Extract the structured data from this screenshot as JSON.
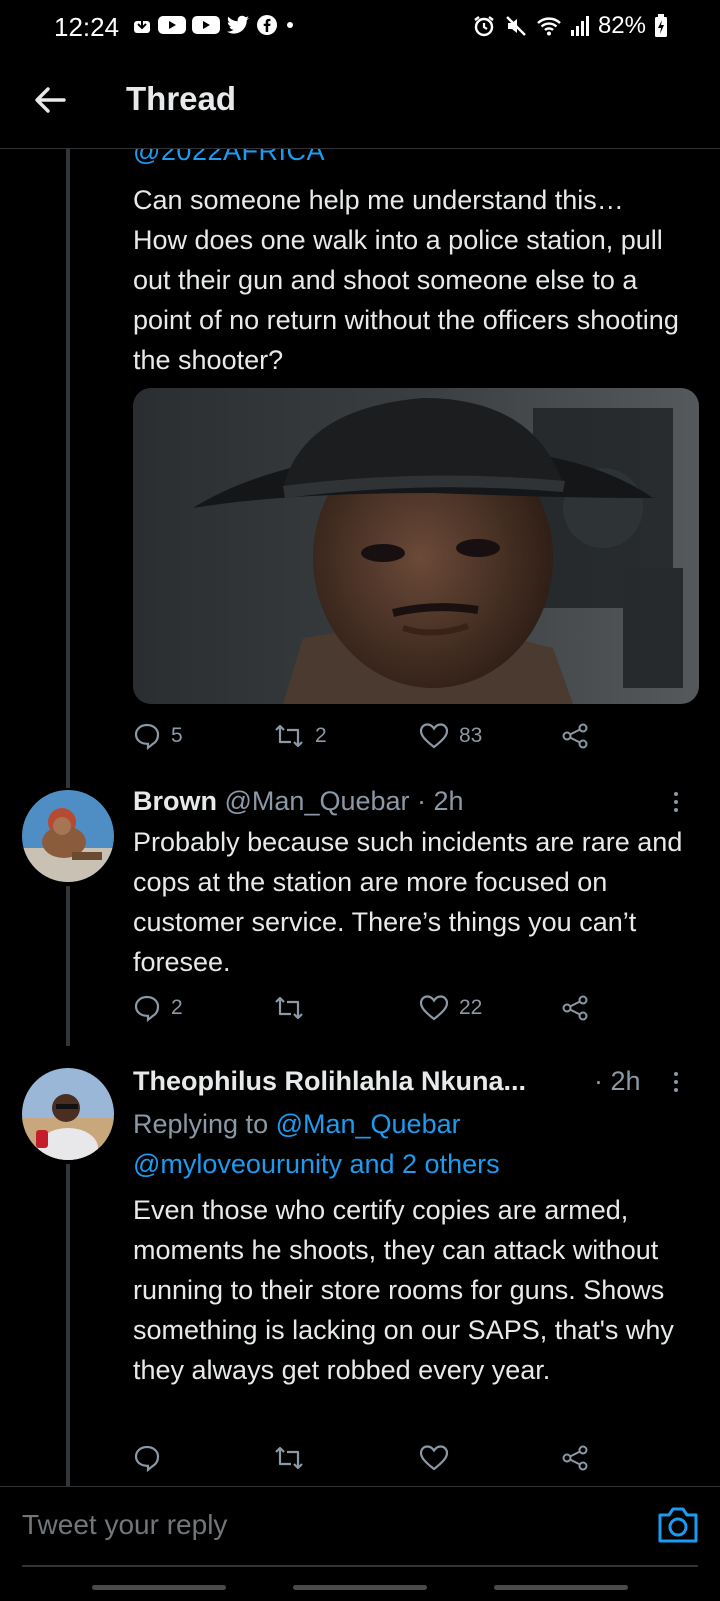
{
  "status_bar": {
    "time": "12:24",
    "battery": "82%"
  },
  "header": {
    "title": "Thread"
  },
  "main_tweet": {
    "mention": "@2022AFRICA",
    "text": "Can someone help me understand this…\nHow does one walk into a police station, pull out their gun and shoot someone else to a point of no return without the officers shooting the shooter?",
    "replies": "5",
    "retweets": "2",
    "likes": "83"
  },
  "reply1": {
    "name": "Brown",
    "handle": "@Man_Quebar",
    "time": "· 2h",
    "text": "Probably because such incidents are rare and cops at the station are more focused on customer service. There’s things you can’t foresee.",
    "replies": "2",
    "likes": "22"
  },
  "reply2": {
    "name": "Theophilus Rolihlahla Nkuna...",
    "time": "· 2h",
    "replying_prefix": "Replying to ",
    "replying_handle": "@Man_Quebar",
    "replying_rest": "@myloveourunity and 2 others",
    "text": "Even those who certify copies are armed, moments he shoots, they can attack without running to their store rooms for guns. Shows something is lacking on our SAPS, that's why they always get robbed every year."
  },
  "composer": {
    "placeholder": "Tweet your reply"
  },
  "colors": {
    "background": "#000000",
    "accent": "#1d9bf0",
    "muted": "#8b98a5",
    "text": "#e7e9ea"
  }
}
